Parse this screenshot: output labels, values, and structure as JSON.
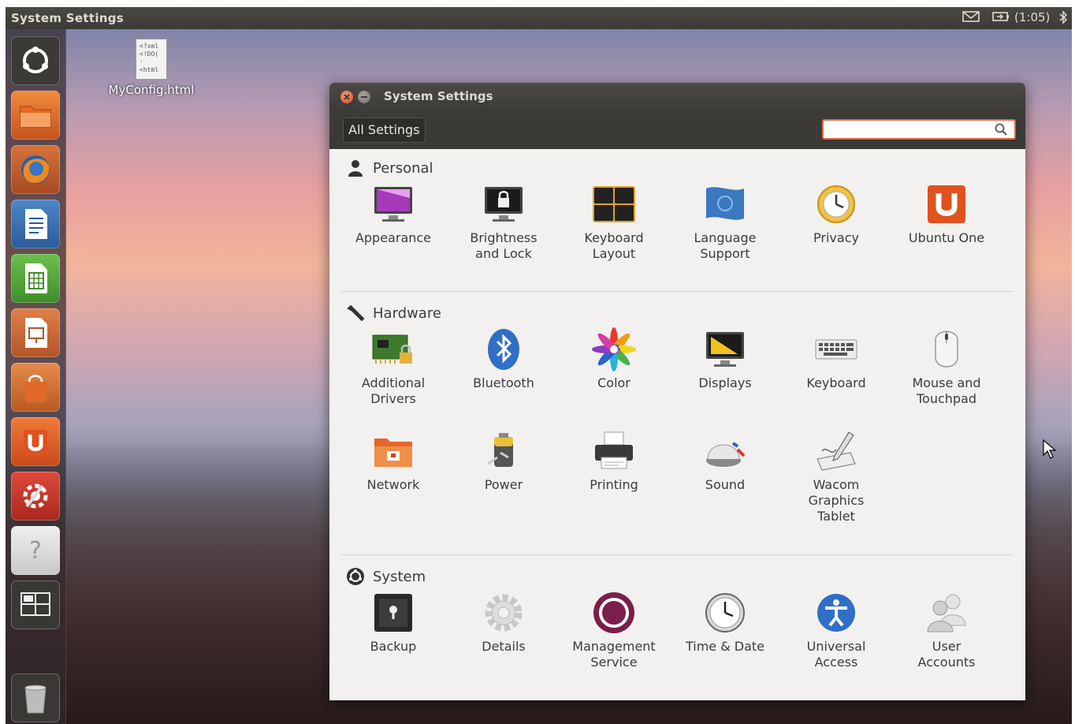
{
  "topbar": {
    "title": "System Settings",
    "battery": "(1:05)"
  },
  "desktop": {
    "file_label": "MyConfig.html",
    "file_preview": [
      "<?xml",
      "<!DO(",
      "·",
      "<html"
    ]
  },
  "window": {
    "title": "System Settings",
    "all_settings": "All Settings",
    "search_placeholder": ""
  },
  "sections": {
    "personal": {
      "label": "Personal",
      "items": [
        "Appearance",
        "Brightness\nand Lock",
        "Keyboard\nLayout",
        "Language\nSupport",
        "Privacy",
        "Ubuntu One"
      ]
    },
    "hardware": {
      "label": "Hardware",
      "items": [
        "Additional\nDrivers",
        "Bluetooth",
        "Color",
        "Displays",
        "Keyboard",
        "Mouse and\nTouchpad",
        "Network",
        "Power",
        "Printing",
        "Sound",
        "Wacom\nGraphics\nTablet"
      ]
    },
    "system": {
      "label": "System",
      "items": [
        "Backup",
        "Details",
        "Management\nService",
        "Time & Date",
        "Universal\nAccess",
        "User\nAccounts"
      ]
    }
  },
  "launcher_icons": [
    "dash-home-icon",
    "files-icon",
    "firefox-icon",
    "writer-icon",
    "calc-icon",
    "impress-icon",
    "software-center-icon",
    "ubuntu-one-icon",
    "system-settings-icon",
    "help-icon",
    "workspace-switcher-icon",
    "trash-icon"
  ]
}
